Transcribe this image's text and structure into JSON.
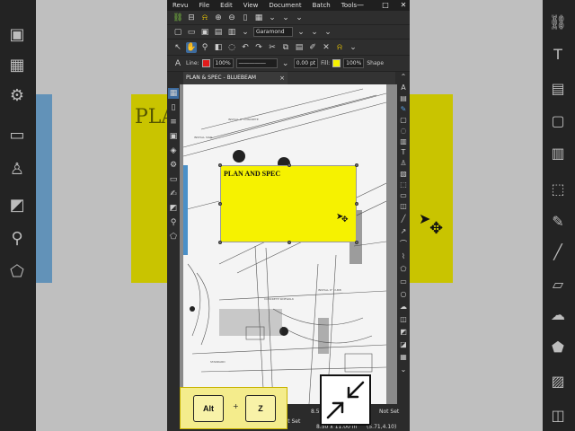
{
  "menu": [
    "Revu",
    "File",
    "Edit",
    "View",
    "Document",
    "Batch",
    "Tools"
  ],
  "window_controls": [
    "—",
    "□",
    "✕"
  ],
  "toolbar": {
    "font": "Garamond",
    "line_label": "Line:",
    "line_opacity": "100%",
    "line_width": "0.00 pt",
    "fill_label": "Fill:",
    "fill_opacity": "100%",
    "shape_label": "Shape",
    "line_color": "#e21b1b",
    "fill_color": "#f6f200"
  },
  "tab": {
    "title": "PLAN & SPEC - BLUEBEAM TUTORIALS*",
    "close": "×"
  },
  "document": {
    "textbox_text": "PLAN AND SPEC",
    "textbox_color": "#f6f200"
  },
  "background": {
    "blurred_text": "PLAN"
  },
  "status": {
    "size": "8.50 x 11.00 in",
    "size_short": "8.5",
    "scale": "Scale Not Set",
    "scale_short": "Not Set",
    "coords": "(5.71,4.10)"
  },
  "shortcut": {
    "key1": "Alt",
    "plus": "+",
    "key2": "Z"
  },
  "icons": {
    "shortcut_icon": "zoom-to-fit-arrows-icon"
  }
}
